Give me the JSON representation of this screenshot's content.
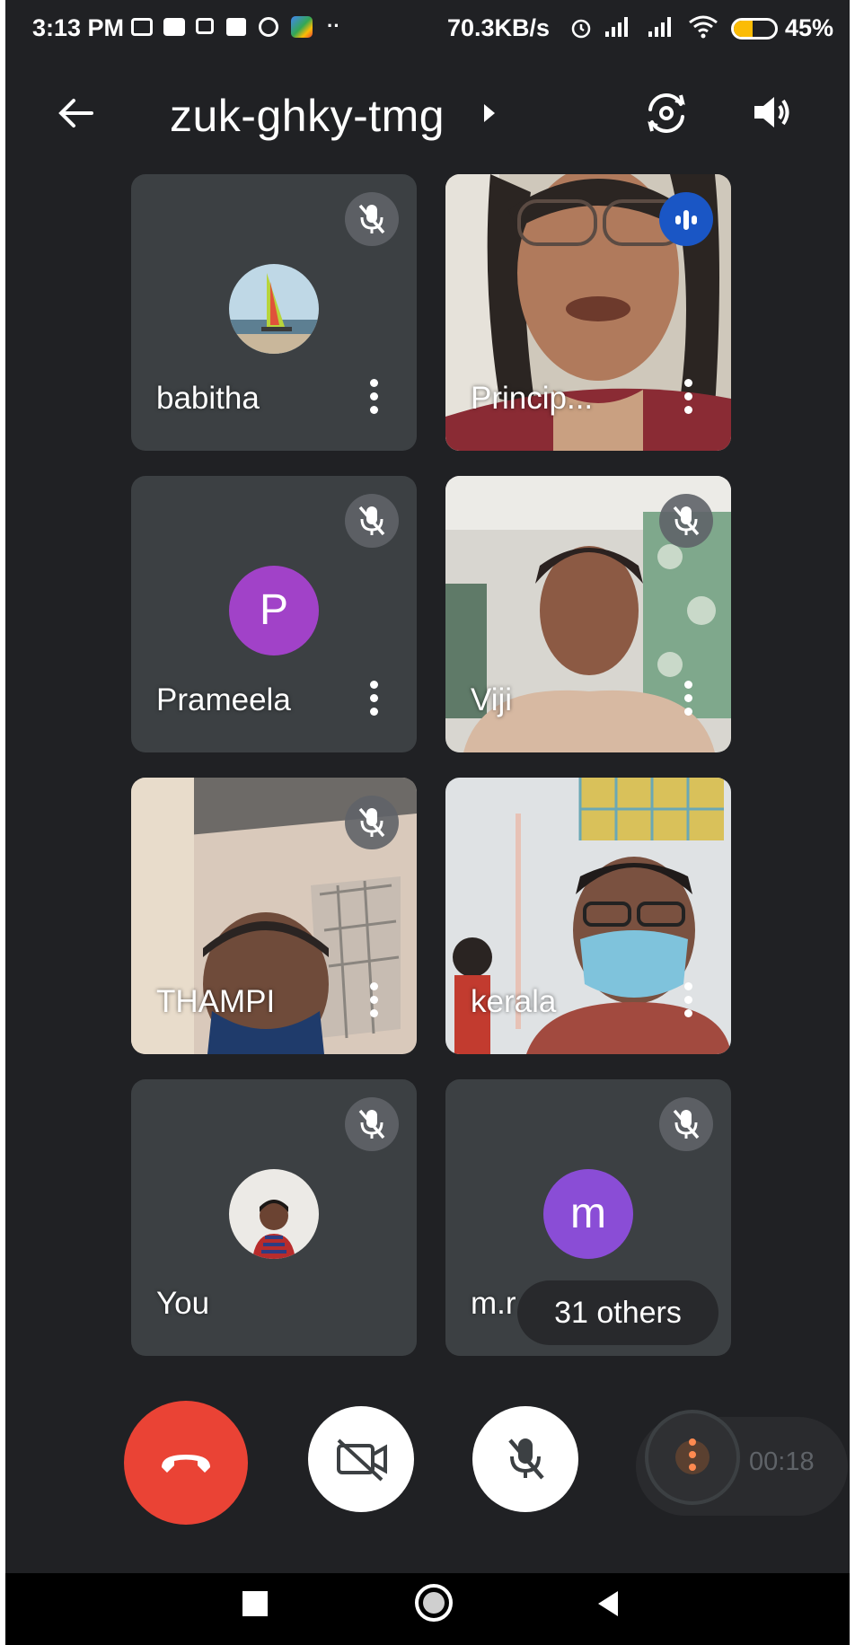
{
  "status_bar": {
    "time": "3:13 PM",
    "network_speed": "70.3KB/s",
    "battery": "45%",
    "battery_level": 0.45
  },
  "top_bar": {
    "meeting_code": "zuk-ghky-tmg"
  },
  "participants": [
    {
      "name": "babitha",
      "avatar": "photo",
      "muted": true
    },
    {
      "name": "Princip...",
      "avatar": "video",
      "speaking": true
    },
    {
      "name": "Prameela",
      "avatar_letter": "P",
      "avatar_color": "#a142c8",
      "muted": true
    },
    {
      "name": "Viji",
      "avatar": "video",
      "muted": true
    },
    {
      "name": "THAMPI",
      "avatar": "video",
      "muted": true
    },
    {
      "name": "kerala",
      "avatar": "video"
    },
    {
      "name": "You",
      "avatar": "photo",
      "muted": true
    },
    {
      "name": "m.r",
      "avatar_letter": "m",
      "avatar_color": "#8a4dd6",
      "muted": true
    }
  ],
  "others_count_label": "31 others",
  "controls": {
    "end_call_color": "#ea4335",
    "camera_state": "off",
    "mic_state": "muted",
    "elapsed": "00:18"
  },
  "icons": {
    "back": "back-arrow-icon",
    "switch_camera": "switch-camera-icon",
    "speaker": "speaker-icon",
    "mic_off": "mic-off-icon",
    "more": "more-vert-icon",
    "speaking": "audio-level-icon",
    "end_call": "call-end-icon",
    "camera_off": "videocam-off-icon",
    "nav_recents": "recents-square-icon",
    "nav_home": "home-circle-icon",
    "nav_back": "nav-back-triangle-icon"
  }
}
